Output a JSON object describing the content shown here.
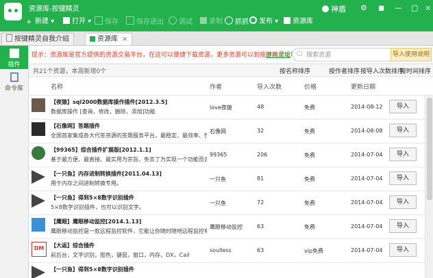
{
  "app": {
    "title": "资源库-按键精灵",
    "user": "神盾"
  },
  "toolbar": [
    {
      "label": "新建",
      "enabled": true
    },
    {
      "label": "打开",
      "enabled": true
    },
    {
      "label": "保存",
      "enabled": false
    },
    {
      "label": "保存退出",
      "enabled": false
    },
    {
      "label": "调试",
      "enabled": false
    },
    {
      "label": "录制",
      "enabled": false
    },
    {
      "label": "抓抓",
      "enabled": true
    },
    {
      "label": "发布",
      "enabled": true
    },
    {
      "label": "资源库",
      "enabled": true
    }
  ],
  "tabs": [
    {
      "label": "按键精灵自我介绍"
    },
    {
      "label": "资源库",
      "close": "×"
    }
  ],
  "sidebar": [
    {
      "label": "插件"
    },
    {
      "label": "命令库"
    }
  ],
  "notice": {
    "text": "提示：资源库是官方提供的资源交易平台，在这可以便捷下载资源，更多资源可以到按键精灵论坛下载。",
    "link": "进入论坛"
  },
  "search": {
    "placeholder": "搜索资源"
  },
  "help_button": "导入使用说明",
  "count": {
    "text": "共21个资源，本周新增0个"
  },
  "sort_options": [
    "按名称排序",
    "按作者排序",
    "按导入次数排序",
    "按时间排序"
  ],
  "columns": {
    "name": "名称",
    "author": "作者",
    "imports": "导入次数",
    "price": "价格",
    "date": "更新日期"
  },
  "import_label": "导入",
  "rows": [
    {
      "title": "【夜猿】sql2000数据库操作插件[2012.3.5]",
      "desc": "数据库操作 [查询，修改，删除，添加]功能",
      "author": "love夜猿",
      "imports": "48",
      "price": "免费",
      "date": "2014-08-12"
    },
    {
      "title": "【石像网】答题插件",
      "desc": "全国首家集成各大代答资源的答题服务平台，最稳定、最效率、性",
      "author": "石像网",
      "imports": "32",
      "price": "免费",
      "date": "2014-08-08"
    },
    {
      "title": "【99365】综合插件扩展版[2012.1.1]",
      "desc": "基于最方便、最直接、最实用为宗旨，免去了为实现一个功能而去写",
      "author": "99365",
      "imports": "206",
      "price": "免费",
      "date": "2014-07-04"
    },
    {
      "title": "【一只鱼】内存进制转换插件[2011.04.13]",
      "desc": "用于内存之间进制转换专用。",
      "author": "一只鱼",
      "imports": "81",
      "price": "免费",
      "date": "2014-07-04"
    },
    {
      "title": "【一只鱼】得到5×8数字识别插件",
      "desc": "5×8数字识别插件，也可以识别文字。",
      "author": "一只鱼",
      "imports": "72",
      "price": "免费",
      "date": "2014-07-04"
    },
    {
      "title": "【鹰眼】鹰眼移动监控[2014.1.13]",
      "desc": "鹰眼移动监控是一款远程监控软件，它能让你随时随地远程监控电",
      "author": "鹰眼移动监控",
      "imports": "63",
      "price": "免费",
      "date": "2014-07-04"
    },
    {
      "title": "【大返】综合插件",
      "desc": "前后台，文字识别，图色，键鼠，窗口，内存，DX，Call",
      "author": "soulless",
      "imports": "63",
      "price": "vip免费",
      "date": "2014-07-04"
    },
    {
      "title": "【一只鱼】得到5×8数字识别插件",
      "desc": "",
      "author": "",
      "imports": "",
      "price": "",
      "date": ""
    }
  ]
}
